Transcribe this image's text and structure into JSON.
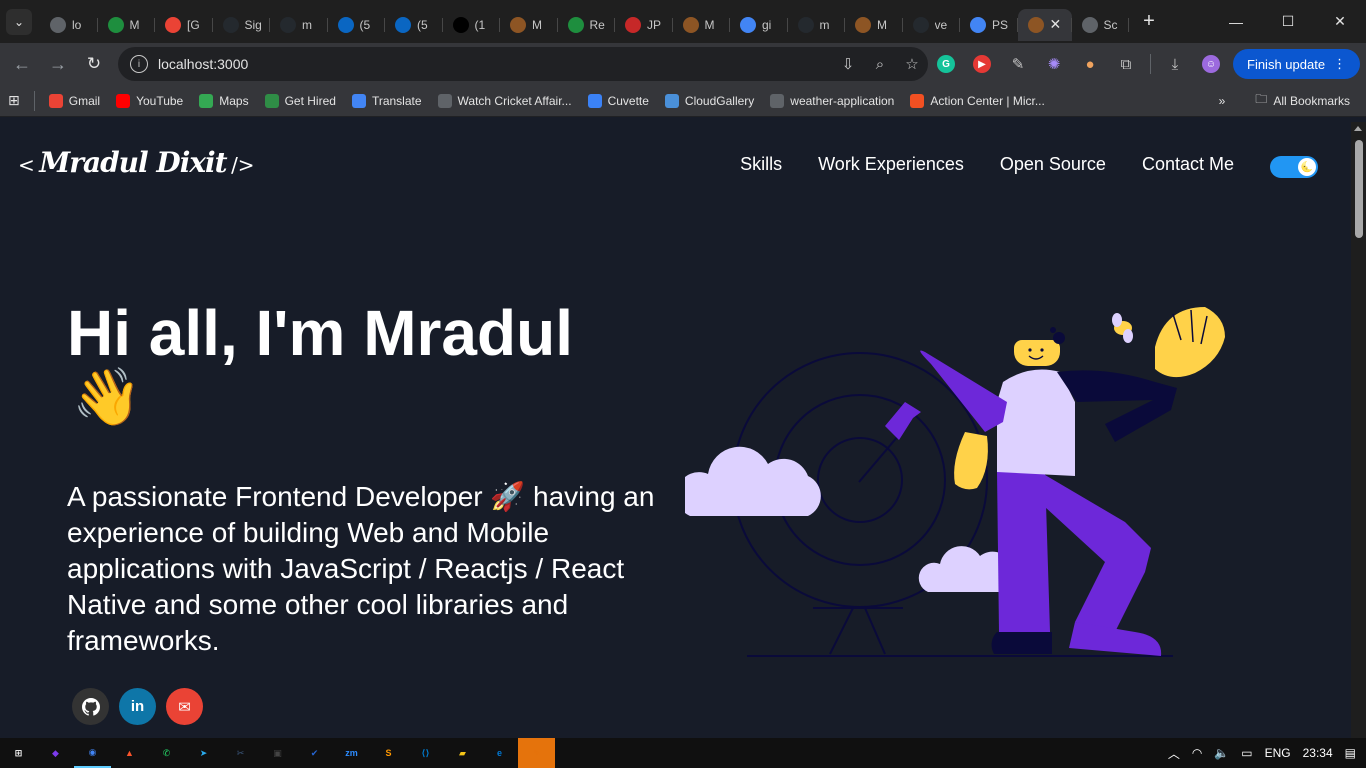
{
  "browser": {
    "tabs": [
      {
        "title": "lo",
        "icon": "globe-icon",
        "color": "#5f6368"
      },
      {
        "title": "M",
        "icon": "google-drive-icon",
        "color": "#1e8e3e"
      },
      {
        "title": "[G",
        "icon": "gmail-icon",
        "color": "#ea4335"
      },
      {
        "title": "Sig",
        "icon": "github-icon",
        "color": "#24292e"
      },
      {
        "title": "m",
        "icon": "github-icon",
        "color": "#24292e"
      },
      {
        "title": "(5",
        "icon": "linkedin-icon",
        "color": "#0a66c2"
      },
      {
        "title": "(5",
        "icon": "linkedin-icon",
        "color": "#0a66c2"
      },
      {
        "title": "(1",
        "icon": "x-icon",
        "color": "#000000"
      },
      {
        "title": "M",
        "icon": "avatar-icon",
        "color": "#8d5524"
      },
      {
        "title": "Re",
        "icon": "google-drive-icon",
        "color": "#1e8e3e"
      },
      {
        "title": "JP",
        "icon": "jpg-png-icon",
        "color": "#c62828"
      },
      {
        "title": "M",
        "icon": "avatar-icon",
        "color": "#8d5524"
      },
      {
        "title": "gi",
        "icon": "google-icon",
        "color": "#4285f4"
      },
      {
        "title": "m",
        "icon": "github-icon",
        "color": "#24292e"
      },
      {
        "title": "M",
        "icon": "avatar-icon",
        "color": "#8d5524"
      },
      {
        "title": "ve",
        "icon": "github-icon",
        "color": "#24292e"
      },
      {
        "title": "PS",
        "icon": "google-icon",
        "color": "#4285f4"
      },
      {
        "title": "",
        "icon": "avatar-icon",
        "color": "#8d5524",
        "active": true
      },
      {
        "title": "Sc",
        "icon": "monitor-icon",
        "color": "#5f6368"
      }
    ],
    "url": "localhost:3000",
    "finish_update_label": "Finish update",
    "bookmarks": [
      {
        "label": "Gmail",
        "icon": "gmail-icon",
        "color": "#ea4335"
      },
      {
        "label": "YouTube",
        "icon": "youtube-icon",
        "color": "#ff0000"
      },
      {
        "label": "Maps",
        "icon": "maps-icon",
        "color": "#34a853"
      },
      {
        "label": "Get Hired",
        "icon": "geeks-icon",
        "color": "#2f8d46"
      },
      {
        "label": "Translate",
        "icon": "translate-icon",
        "color": "#4285f4"
      },
      {
        "label": "Watch Cricket Affair...",
        "icon": "globe-icon",
        "color": "#5f6368"
      },
      {
        "label": "Cuvette",
        "icon": "cuvette-icon",
        "color": "#3b82f6"
      },
      {
        "label": "CloudGallery",
        "icon": "gallery-icon",
        "color": "#4a90d9"
      },
      {
        "label": "weather-application",
        "icon": "globe-icon",
        "color": "#5f6368"
      },
      {
        "label": "Action Center | Micr...",
        "icon": "microsoft-icon",
        "color": "#f25022"
      }
    ],
    "all_bookmarks_label": "All Bookmarks"
  },
  "site": {
    "logo_text": "Mradul Dixit",
    "nav": [
      "Skills",
      "Work Experiences",
      "Open Source",
      "Contact Me"
    ],
    "greeting": "Hi all, I'm Mradul",
    "wave_emoji": "👋",
    "subtitle": "A passionate Frontend Developer 🚀 having an experience of building Web and Mobile applications with JavaScript / Reactjs / React Native and some other cool libraries and frameworks.",
    "socials": [
      {
        "name": "github",
        "glyph": "⌥"
      },
      {
        "name": "linkedin",
        "glyph": "in"
      },
      {
        "name": "email",
        "glyph": "✉"
      }
    ],
    "toggle_on": true,
    "colors": {
      "background": "#171c28",
      "accent": "#2196f3",
      "figure_purple": "#6d28d9",
      "figure_lavender": "#ddd1ff",
      "figure_yellow": "#ffd249"
    }
  },
  "taskbar": {
    "apps": [
      {
        "name": "windows-start-icon"
      },
      {
        "name": "copilot-icon"
      },
      {
        "name": "chrome-icon",
        "active": true
      },
      {
        "name": "brave-icon"
      },
      {
        "name": "whatsapp-icon"
      },
      {
        "name": "telegram-icon"
      },
      {
        "name": "snipping-icon"
      },
      {
        "name": "terminal-icon"
      },
      {
        "name": "todo-icon"
      },
      {
        "name": "zoom-icon"
      },
      {
        "name": "sublime-icon"
      },
      {
        "name": "vscode-icon"
      },
      {
        "name": "file-explorer-icon"
      },
      {
        "name": "edge-icon"
      },
      {
        "name": "paint-icon",
        "highlighted": true
      }
    ],
    "language": "ENG",
    "time": "23:34"
  }
}
